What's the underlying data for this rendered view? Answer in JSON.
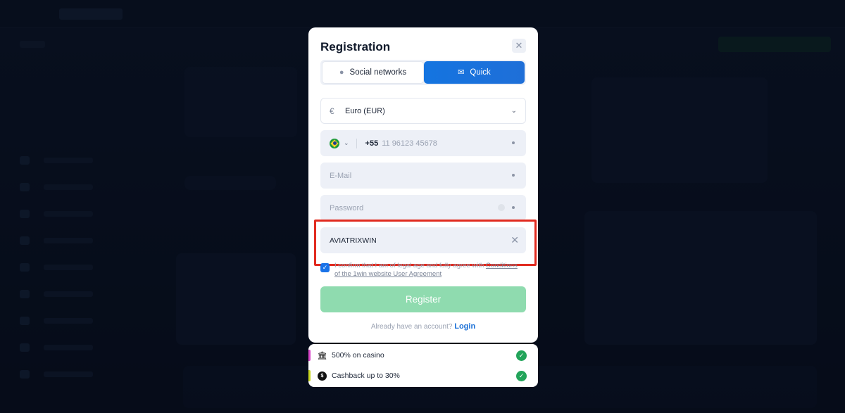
{
  "modal": {
    "title": "Registration",
    "close_icon": "close-icon",
    "tabs": [
      {
        "label": "Social networks",
        "icon": "chat-bubble-icon",
        "active": false
      },
      {
        "label": "Quick",
        "icon": "envelope-icon",
        "active": true
      }
    ],
    "currency": {
      "symbol": "€",
      "value": "Euro (EUR)"
    },
    "phone": {
      "country_flag": "brazil-flag-icon",
      "dial_code": "+55",
      "placeholder": "11 96123 45678"
    },
    "email": {
      "placeholder": "E-Mail"
    },
    "password": {
      "placeholder": "Password"
    },
    "promo": {
      "value": "AVIATRIXWIN"
    },
    "agreement": {
      "prefix": "I confirm that I am of legal age and fully agree with ",
      "link": "Conditions of the 1win website User Agreement",
      "checked": true
    },
    "register_label": "Register",
    "login_prompt": "Already have an account?",
    "login_link": "Login"
  },
  "bonuses": [
    {
      "label": "500% on casino",
      "icon": "casino-icon",
      "stripe_color": "#d946c8"
    },
    {
      "label": "Cashback up to 30%",
      "icon": "cashback-coin-icon",
      "stripe_color": "#c8d61f"
    }
  ],
  "colors": {
    "primary": "#1a73e8",
    "register": "#8fdbaf",
    "highlight": "#e12a1f",
    "check": "#22a45a"
  }
}
